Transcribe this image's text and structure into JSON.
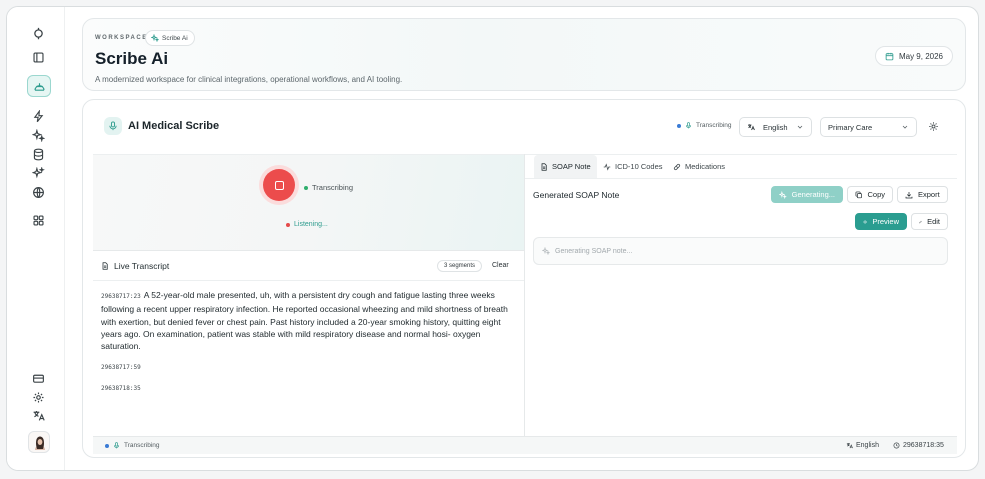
{
  "colors": {
    "accent": "#2a9d90",
    "record": "#ec4c4c",
    "accent_light": "#8fd0c7"
  },
  "header": {
    "workspace_label": "WORKSPACE",
    "workspace_chip": "Scribe Ai",
    "title": "Scribe Ai",
    "subtitle": "A modernized workspace for clinical integrations, operational workflows, and AI tooling.",
    "date": "May 9, 2026"
  },
  "scribe": {
    "title": "AI Medical Scribe",
    "status": "Transcribing",
    "language": "English",
    "specialty": "Primary Care"
  },
  "recorder": {
    "state": "Transcribing",
    "listening": "Listening..."
  },
  "transcript": {
    "title": "Live Transcript",
    "segments": "3 segments",
    "clear_label": "Clear",
    "entries": [
      {
        "ts": "29638717:23",
        "text": "A 52-year-old male presented, uh, with a persistent dry cough and fatigue lasting three weeks following a recent upper respiratory infection. He reported occasional wheezing and mild shortness of breath with exertion, but denied fever or chest pain. Past history included a 20-year smoking history, quitting eight years ago. On examination, patient was stable with mild respiratory disease and normal hosi- oxygen saturation."
      },
      {
        "ts": "29638717:59",
        "text": ""
      },
      {
        "ts": "29638718:35",
        "text": ""
      }
    ]
  },
  "soap": {
    "tabs": [
      "SOAP Note",
      "ICD-10 Codes",
      "Medications"
    ],
    "title": "Generated SOAP Note",
    "generating_label": "Generating...",
    "copy_label": "Copy",
    "export_label": "Export",
    "preview_label": "Preview",
    "edit_label": "Edit",
    "placeholder": "Generating SOAP note..."
  },
  "footer": {
    "status": "Transcribing",
    "language": "English",
    "time": "29638718:35"
  },
  "icons": {
    "sidebar": [
      "brand-icon",
      "panel-icon",
      "dashboard-icon",
      "bolt-icon",
      "sparkle-icon",
      "database-icon",
      "sparkles-icon",
      "globe-icon",
      "grid-icon",
      "card-icon",
      "settings-icon",
      "translate-icon"
    ]
  }
}
